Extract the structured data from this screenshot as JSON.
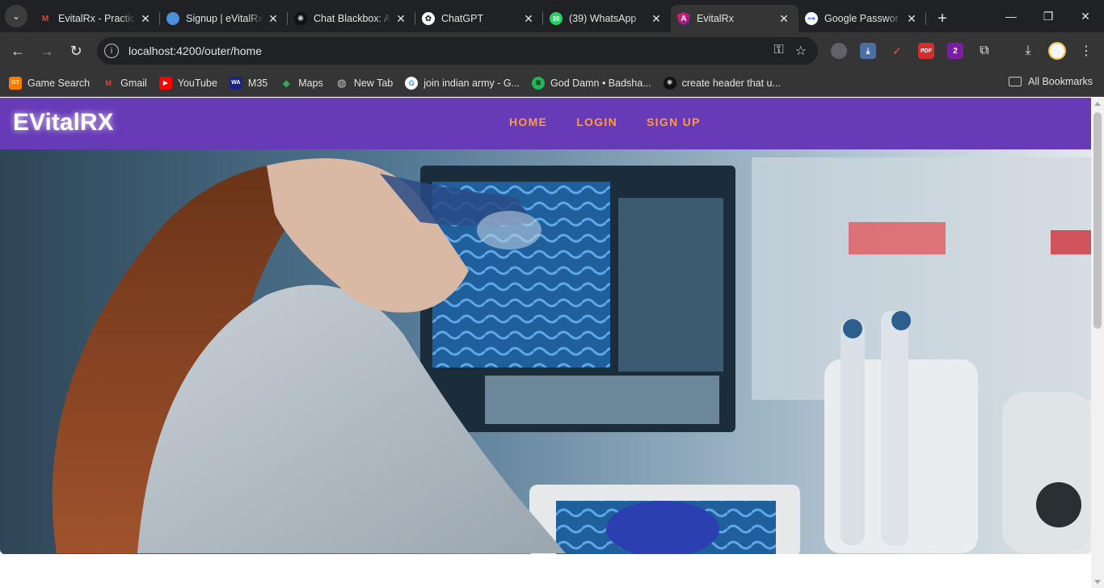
{
  "browser": {
    "tabs": [
      {
        "title": "EvitalRx - Practic",
        "icon": "gmail-icon",
        "color": "#ea4335"
      },
      {
        "title": "Signup | eVitalRx",
        "icon": "evitalrx-icon",
        "color": "#4a90d9"
      },
      {
        "title": "Chat Blackbox: A",
        "icon": "blackbox-icon",
        "color": "#111111"
      },
      {
        "title": "ChatGPT",
        "icon": "chatgpt-icon",
        "color": "#ffffff"
      },
      {
        "title": "(39) WhatsApp",
        "icon": "whatsapp-icon",
        "color": "#25d366",
        "badge": "39"
      },
      {
        "title": "EvitalRx",
        "icon": "angular-icon",
        "color": "#c2185b",
        "active": true
      },
      {
        "title": "Google Passwor",
        "icon": "google-password-icon",
        "color": "#ffffff"
      }
    ],
    "url": "localhost:4200/outer/home",
    "bookmarks": [
      {
        "label": "Game Search",
        "icon": "game-search-icon",
        "color": "#f57c00",
        "glyph": "GT"
      },
      {
        "label": "Gmail",
        "icon": "gmail-icon",
        "color": "#ea4335",
        "glyph": "M"
      },
      {
        "label": "YouTube",
        "icon": "youtube-icon",
        "color": "#ff0000",
        "glyph": "▶"
      },
      {
        "label": "M35",
        "icon": "wa-icon",
        "color": "#1a237e",
        "glyph": "WA"
      },
      {
        "label": "Maps",
        "icon": "maps-icon",
        "color": "#34a853",
        "glyph": "◆"
      },
      {
        "label": "New Tab",
        "icon": "globe-icon",
        "color": "#5f6368",
        "glyph": "◍"
      },
      {
        "label": "join indian army - G...",
        "icon": "google-icon",
        "color": "#4285f4",
        "glyph": "G"
      },
      {
        "label": "God Damn • Badsha...",
        "icon": "spotify-icon",
        "color": "#1db954",
        "glyph": "≋"
      },
      {
        "label": "create header that u...",
        "icon": "blackbox-icon",
        "color": "#111111",
        "glyph": "✺"
      }
    ],
    "all_bookmarks_label": "All Bookmarks"
  },
  "app": {
    "brand": "EVitalRX",
    "nav": [
      {
        "label": "HOME"
      },
      {
        "label": "LOGIN"
      },
      {
        "label": "SIGN UP"
      }
    ],
    "colors": {
      "appbar": "#673ab7",
      "nav_link": "#ff9a3d"
    },
    "hero": {
      "subject": "lab-scientist-microscope-photo"
    }
  }
}
